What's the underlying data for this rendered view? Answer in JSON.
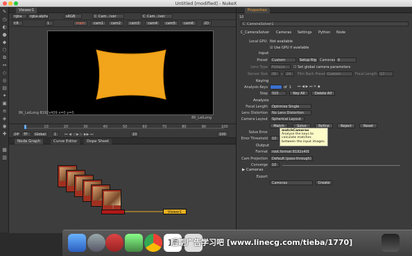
{
  "window": {
    "title": "Untitled [modified] - NukeX"
  },
  "viewer": {
    "tab": "Viewer1",
    "channels": "rgba",
    "layer": "rgba.alpha",
    "colorspace": "sRGB",
    "input_a": "C_Cam...lver",
    "input_b": "C_Cam...lver",
    "frame_prefix": "f/8",
    "frame_num": "1",
    "cam_tabs": [
      "main",
      "cam1",
      "cam2",
      "cam3",
      "cam4",
      "cam5",
      "cam6"
    ],
    "view_mode": "2D",
    "format_label": "8K_LatLong",
    "status_line": "8K_LatLong 8192x409  x=0 y=0",
    "tl_ticks": [
      "1",
      "10",
      "20",
      "30",
      "40",
      "50",
      "60",
      "70",
      "80",
      "90",
      "100"
    ],
    "fps": "24*",
    "tf": "TF",
    "global": "Global",
    "frame_in": "1",
    "frame_out": "100",
    "frame_step": "10"
  },
  "node_graph": {
    "tabs": [
      "Node Graph",
      "Curve Editor",
      "Dope Sheet"
    ],
    "viewer_node": "Viewer1"
  },
  "properties": {
    "tab": "Properties",
    "count": "10",
    "node_name": "C_CameraSolver1",
    "tabs": [
      "C_CameraSolver",
      "Cameras",
      "Settings",
      "Python",
      "Node"
    ],
    "local_gpu_label": "Local GPU:",
    "local_gpu_value": "Not available",
    "use_gpu_label": "Use GPU if available",
    "input_section": "Input",
    "preset_label": "Preset",
    "preset_value": "Custom",
    "setup_rig": "Setup Rig",
    "cameras_label": "Cameras",
    "cameras_value": "6",
    "lens_type_label": "Lens Type",
    "lens_type_value": "Fisheye",
    "set_global": "Set global camera parameters",
    "sensor_size_label": "Sensor Size",
    "sensor_w": "36",
    "sensor_x": "x",
    "sensor_h": "24",
    "film_back_label": "Film Back Preset",
    "film_back_value": "Custom",
    "focal_length_label": "Focal Length",
    "focal_length_value": "17",
    "keying_section": "Keying",
    "analysis_keys_label": "Analysis Keys",
    "analysis_of": "of",
    "analysis_total": "1",
    "step_label": "Step",
    "step_value": "500",
    "key_all": "Key All",
    "delete_all": "Delete All",
    "analysis_section": "Analysis",
    "focal_len2_label": "Focal Length",
    "focal_len2_value": "Optimise Single",
    "lens_dist_label": "Lens Distortion",
    "lens_dist_value": "No Lens Distortion",
    "cam_layout_label": "Camera Layout",
    "cam_layout_value": "Spherical Layout",
    "btn_match": "Match",
    "btn_solve": "Solve",
    "btn_refine": "Refine",
    "btn_reject": "Reject",
    "btn_reset": "Reset",
    "solve_error_label": "Solve Error",
    "error_threshold_label": "Error Threshold",
    "error_threshold_value": "10",
    "output_section": "Output",
    "format_label": "Format",
    "format_value": "root.format 8192x4096",
    "cam_proj_label": "Cam Projection",
    "cam_proj_value": "Default (pass-through)",
    "converge_label": "Converge",
    "converge_value": "10",
    "cameras_section": "Cameras",
    "export_label": "Export",
    "export_value": "Cameras",
    "create_btn": "Create",
    "tooltip_title": "matchCameras",
    "tooltip_body": "Analyse the keys to calculate matches between the input images."
  },
  "overlay": {
    "text": "后期广告学习吧 [www.linecg.com/tieba/1770]"
  },
  "dock": {
    "calendar_day": "16"
  }
}
